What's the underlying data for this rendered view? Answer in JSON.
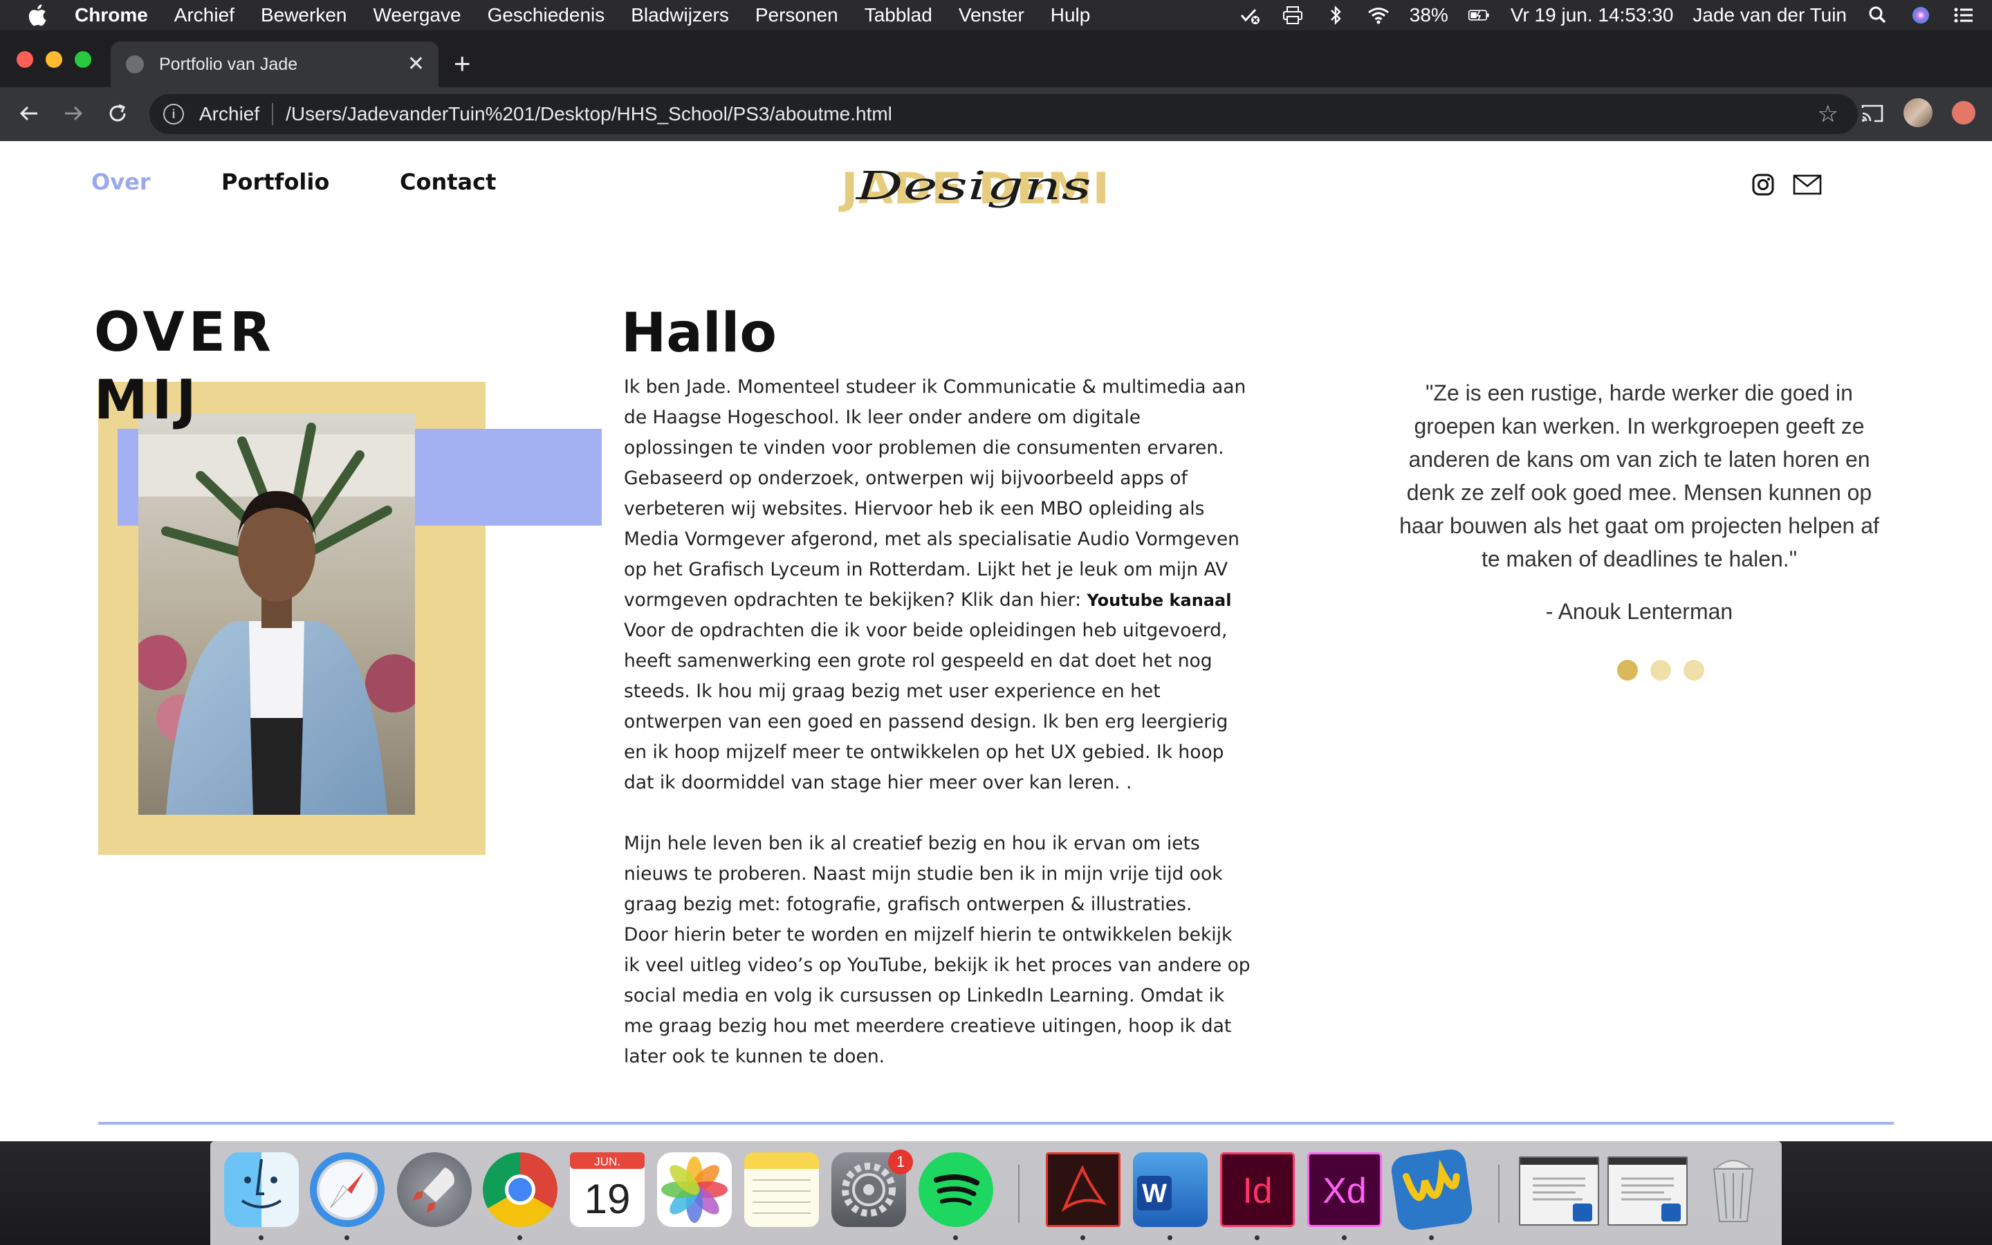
{
  "menubar": {
    "app": "Chrome",
    "items": [
      "Archief",
      "Bewerken",
      "Weergave",
      "Geschiedenis",
      "Bladwijzers",
      "Personen",
      "Tabblad",
      "Venster",
      "Hulp"
    ],
    "battery": "38%",
    "datetime": "Vr 19 jun.  14:53:30",
    "user": "Jade van der Tuin"
  },
  "browser": {
    "tab_title": "Portfolio van Jade",
    "new_tab": "+",
    "tab_close": "✕",
    "url_prefix": "Archief",
    "url": "/Users/JadevanderTuin%201/Desktop/HHS_School/PS3/aboutme.html"
  },
  "site": {
    "nav": [
      "Over",
      "Portfolio",
      "Contact"
    ],
    "logo_main": "JADE DEMI",
    "logo_script": "Designs",
    "heading_line1": "OVER",
    "heading_line2": "MIJ",
    "hallo": "Hallo",
    "bio_p1": "Ik ben Jade. Momenteel studeer ik Communicatie & multimedia aan de Haagse Hogeschool. Ik leer onder andere om digitale oplossingen te vinden voor problemen die consumenten ervaren. Gebaseerd op onderzoek, ontwerpen wij bijvoorbeeld apps of verbeteren wij websites. Hiervoor heb ik een MBO opleiding als Media Vormgever afgerond, met als specialisatie Audio Vormgeven op het Grafisch Lyceum in Rotterdam. Lijkt het je leuk om mijn AV vormgeven opdrachten te bekijken? Klik dan hier: ",
    "youtube_link": "Youtube kanaal",
    "bio_p2": "Voor de opdrachten die ik voor beide opleidingen heb uitgevoerd, heeft samenwerking een grote rol gespeeld en dat doet het nog steeds. Ik hou mij graag bezig met user experience en het ontwerpen van een goed en passend design. Ik ben erg leergierig en ik hoop mijzelf meer te ontwikkelen op het UX gebied. Ik hoop dat ik doormiddel van stage hier meer over kan leren. .",
    "bio_p3": "Mijn hele leven ben ik al creatief bezig en hou ik ervan om iets nieuws te proberen. Naast mijn studie ben ik in mijn vrije tijd ook graag bezig met: fotografie, grafisch ontwerpen & illustraties.",
    "bio_p4": "Door hierin beter te worden en mijzelf hierin te ontwikkelen bekijk ik veel uitleg video’s op YouTube, bekijk ik het proces van andere op social media en volg ik cursussen op LinkedIn Learning. Omdat ik me graag bezig hou met meerdere creatieve uitingen, hoop ik dat later ook te kunnen te doen.",
    "quote": "\"Ze is een rustige, harde werker die goed in groepen kan werken. In werkgroepen geeft ze anderen de kans om van zich te laten horen en denk ze zelf ook goed mee. Mensen kunnen op haar bouwen als het gaat om projecten helpen af te maken of deadlines te halen.\"",
    "quote_author": "- Anouk Lenterman"
  },
  "dock": {
    "calendar_month": "JUN.",
    "calendar_day": "19",
    "system_prefs_badge": "1",
    "word_letter": "W",
    "indesign_label": "Id",
    "xd_label": "Xd"
  },
  "colors": {
    "accent_blue": "#a3b1f3",
    "accent_yellow": "#ecd691",
    "nav_active": "#9aa9ee",
    "dot_active": "#d9b95a",
    "dot_inactive": "#efe0a9"
  }
}
